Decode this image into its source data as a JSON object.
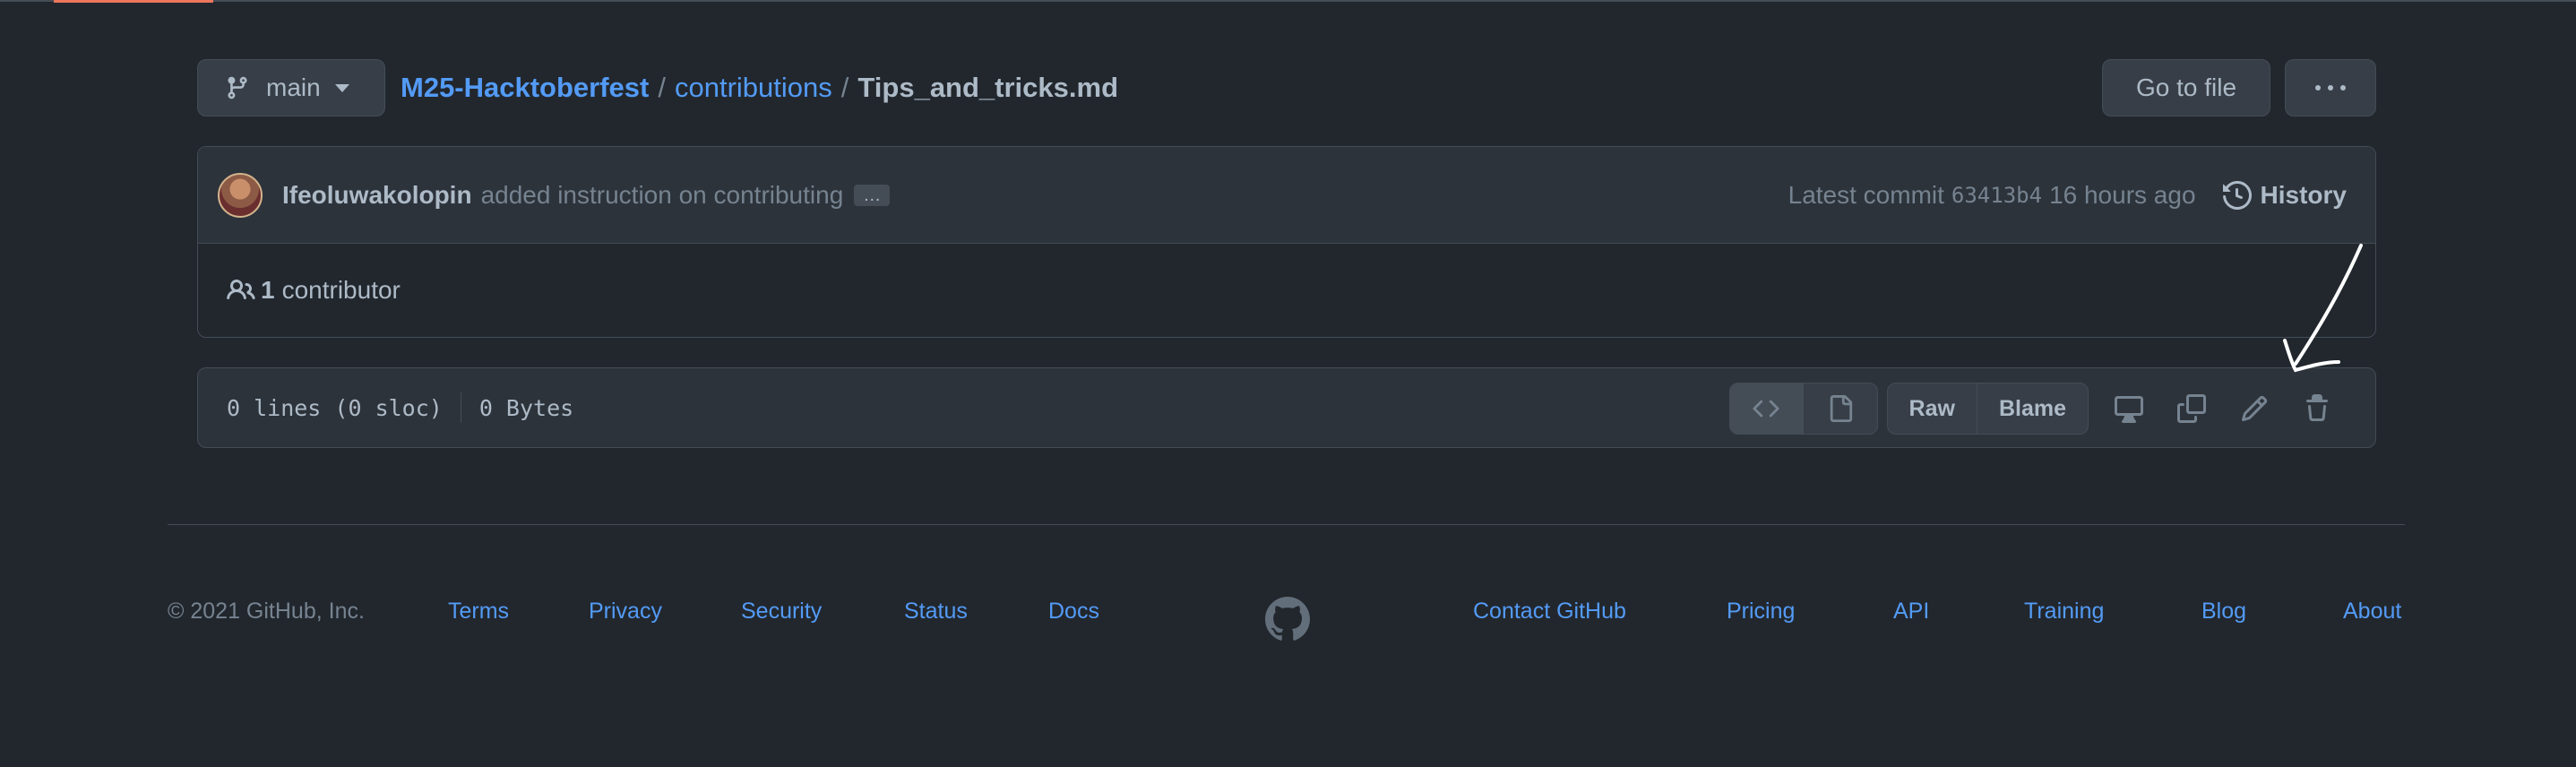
{
  "branch": {
    "name": "main"
  },
  "breadcrumb": {
    "repo": "M25-Hacktoberfest",
    "sep1": "/",
    "folder": "contributions",
    "sep2": "/",
    "file": "Tips_and_tricks.md"
  },
  "header_actions": {
    "go_to_file": "Go to file",
    "more": "..."
  },
  "commit": {
    "author": "Ifeoluwakolopin",
    "message": "added instruction on contributing",
    "ellipsis": "…",
    "latest_label": "Latest commit",
    "sha": "63413b4",
    "time": "16 hours ago",
    "history_label": "History"
  },
  "contributors": {
    "count": "1",
    "label": "contributor"
  },
  "file_info": {
    "lines": "0 lines (0 sloc)",
    "size": "0 Bytes"
  },
  "file_actions": {
    "raw": "Raw",
    "blame": "Blame"
  },
  "icons": [
    "branch-icon",
    "history-icon",
    "people-icon",
    "code-icon",
    "file-icon",
    "desktop-icon",
    "copy-icon",
    "pencil-icon",
    "trash-icon",
    "github-logo-icon"
  ],
  "footer": {
    "copyright": "© 2021 GitHub, Inc.",
    "links_left": [
      "Terms",
      "Privacy",
      "Security",
      "Status",
      "Docs"
    ],
    "links_right": [
      "Contact GitHub",
      "Pricing",
      "API",
      "Training",
      "Blog",
      "About"
    ]
  },
  "colors": {
    "bg": "#22272e",
    "link": "#539bf5",
    "accent": "#ec775c"
  }
}
